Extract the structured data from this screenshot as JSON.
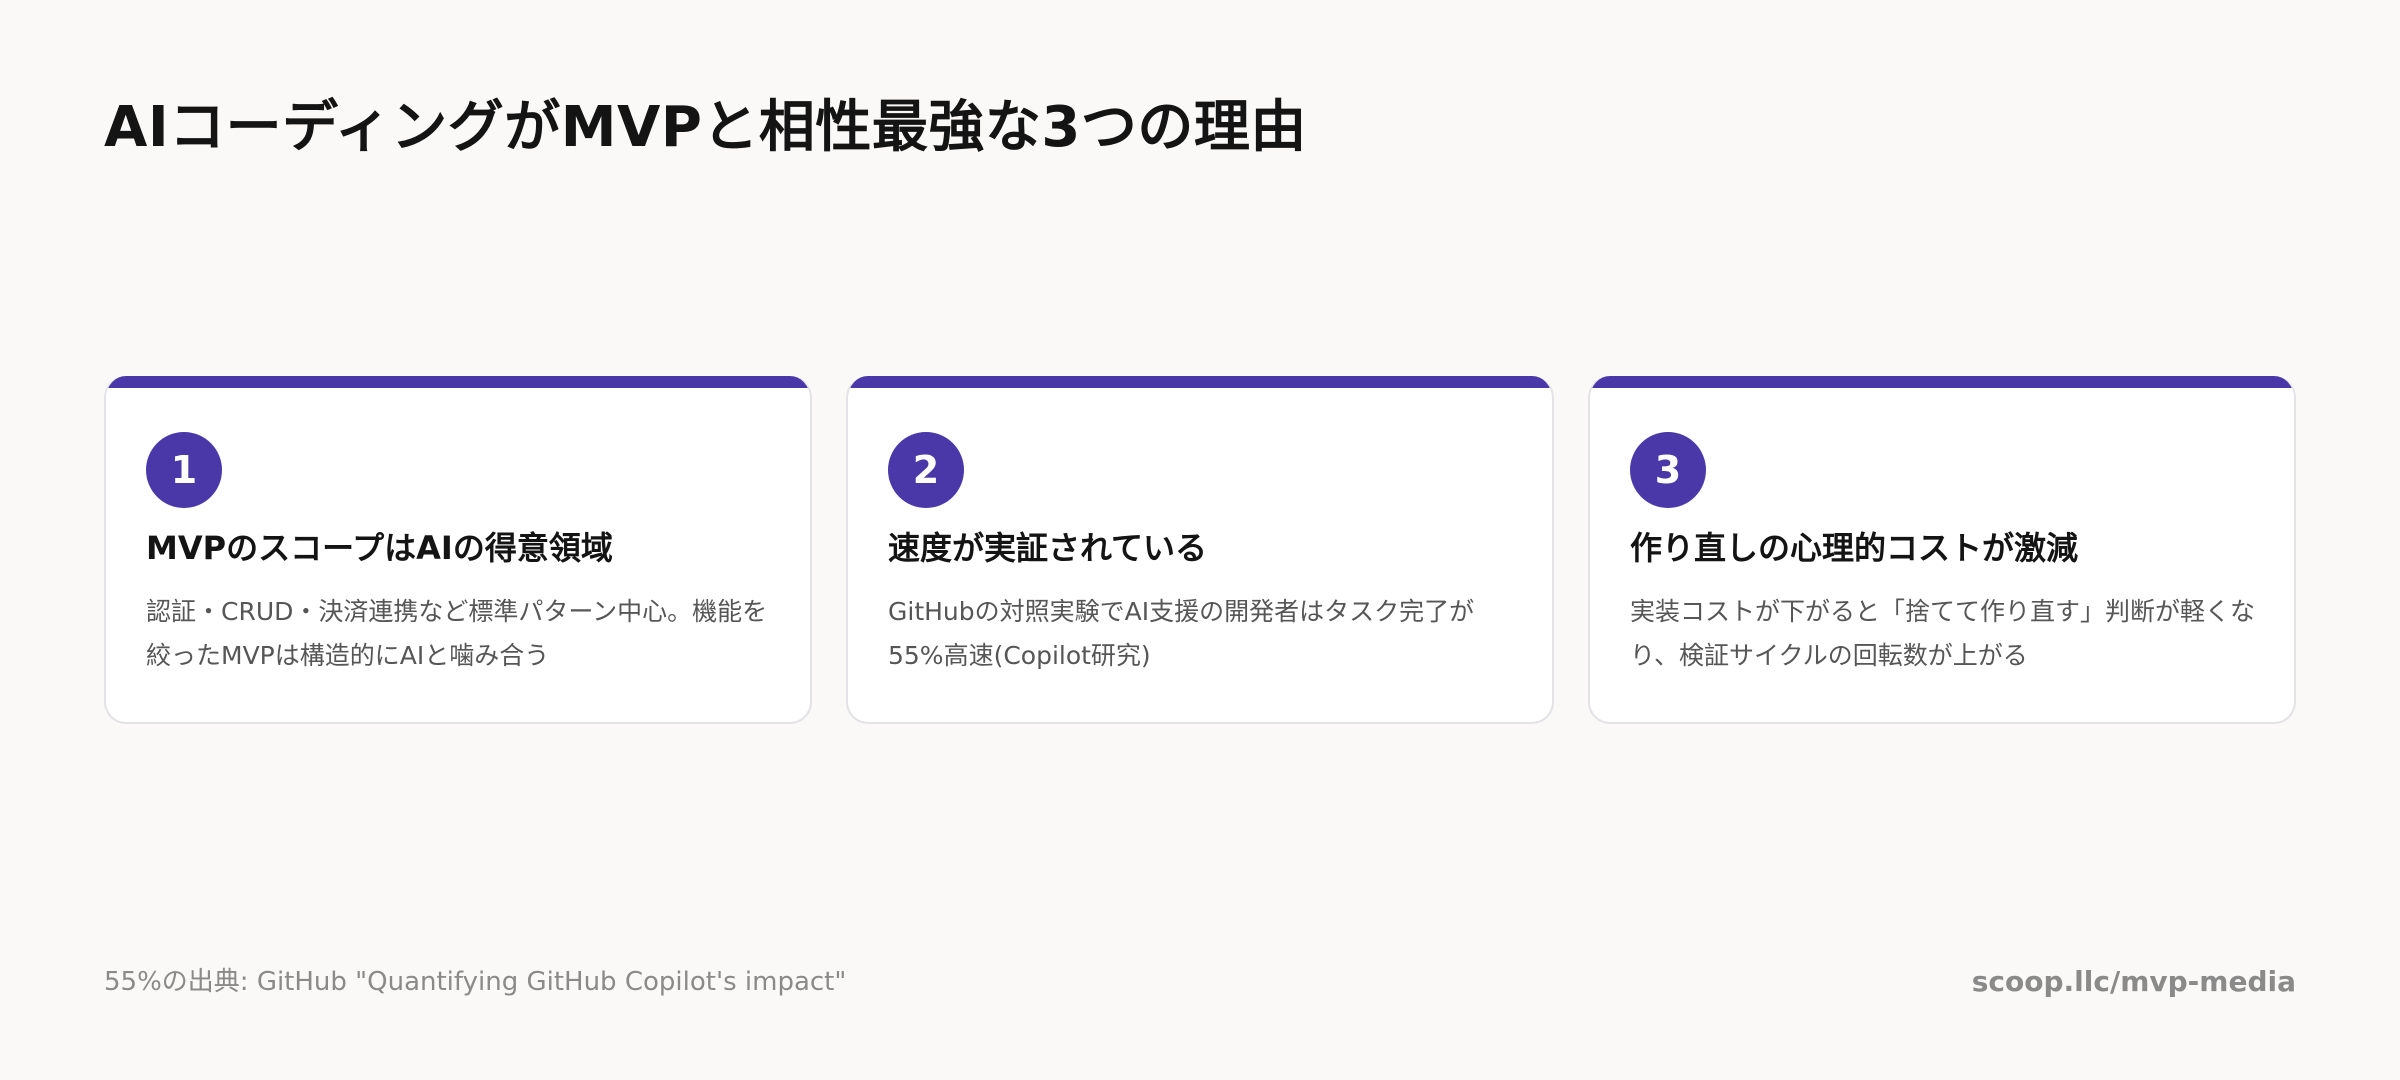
{
  "title": "AIコーディングがMVPと相性最強な3つの理由",
  "colors": {
    "accent": "#4a38a8",
    "background": "#faf9f7",
    "card": "#ffffff",
    "muted_text": "#8a8a8a"
  },
  "cards": [
    {
      "number": "1",
      "heading": "MVPのスコープはAIの得意領域",
      "body": "認証・CRUD・決済連携など標準パターン中心。機能を絞ったMVPは構造的にAIと噛み合う"
    },
    {
      "number": "2",
      "heading": "速度が実証されている",
      "body": "GitHubの対照実験でAI支援の開発者はタスク完了が55%高速(Copilot研究)"
    },
    {
      "number": "3",
      "heading": "作り直しの心理的コストが激減",
      "body": "実装コストが下がると「捨てて作り直す」判断が軽くなり、検証サイクルの回転数が上がる"
    }
  ],
  "footer": {
    "source": "55%の出典: GitHub \"Quantifying GitHub Copilot's impact\"",
    "url": "scoop.llc/mvp-media"
  }
}
